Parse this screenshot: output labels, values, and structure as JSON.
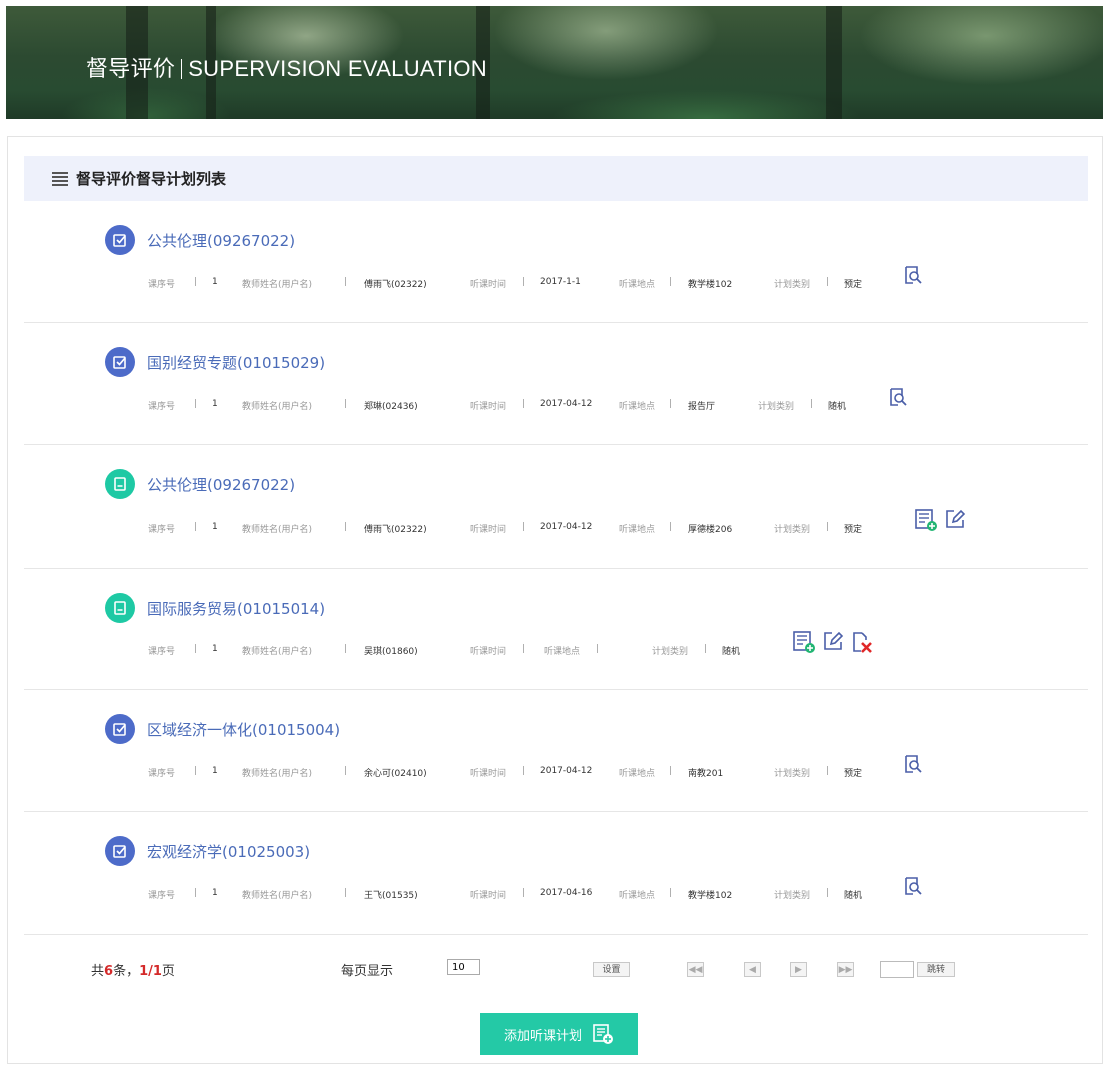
{
  "header": {
    "title_cn": "督导评价",
    "title_en": "SUPERVISION EVALUATION"
  },
  "panel": {
    "title": "督导评价督导计划列表"
  },
  "labels": {
    "seq": "课序号",
    "teacher": "教师姓名(用户名)",
    "time": "听课时间",
    "place": "听课地点",
    "category": "计划类别",
    "sep": "|"
  },
  "records": [
    {
      "status": "completed",
      "course": "公共伦理(09267022)",
      "seq": "1",
      "teacher": "傅雨飞(02322)",
      "time": "2017-1-1",
      "place": "教学楼102",
      "category": "预定",
      "actions": [
        "view-icon"
      ]
    },
    {
      "status": "completed",
      "course": "国别经贸专题(01015029)",
      "seq": "1",
      "teacher": "郑琳(02436)",
      "time": "2017-04-12",
      "place": "报告厅",
      "category": "随机",
      "actions": [
        "view-icon"
      ]
    },
    {
      "status": "pending",
      "course": "公共伦理(09267022)",
      "seq": "1",
      "teacher": "傅雨飞(02322)",
      "time": "2017-04-12",
      "place": "厚德楼206",
      "category": "预定",
      "actions": [
        "add-record-icon",
        "edit-icon"
      ]
    },
    {
      "status": "pending",
      "course": "国际服务贸易(01015014)",
      "seq": "1",
      "teacher": "吴琪(01860)",
      "time": "",
      "place": "",
      "category": "随机",
      "actions": [
        "add-record-icon",
        "edit-icon",
        "delete-icon"
      ]
    },
    {
      "status": "completed",
      "course": "区域经济一体化(01015004)",
      "seq": "1",
      "teacher": "余心可(02410)",
      "time": "2017-04-12",
      "place": "南教201",
      "category": "预定",
      "actions": [
        "view-icon"
      ]
    },
    {
      "status": "completed",
      "course": "宏观经济学(01025003)",
      "seq": "1",
      "teacher": "王飞(01535)",
      "time": "2017-04-16",
      "place": "教学楼102",
      "category": "随机",
      "actions": [
        "view-icon"
      ]
    }
  ],
  "pager": {
    "total_prefix": "共",
    "total_count": "6",
    "total_mid": "条，",
    "current_page": "1",
    "slash": "/",
    "total_pages": "1",
    "page_suffix": "页",
    "per_page_label": "每页显示",
    "per_page_value": "10",
    "set_button": "设置",
    "first": "◀◀",
    "prev": "◀",
    "next": "▶",
    "last": "▶▶",
    "jump_button": "跳转"
  },
  "add_button": {
    "label": "添加听课计划"
  },
  "colors": {
    "completed_icon": "#4d6bc9",
    "pending_icon": "#1ec9a4",
    "link": "#4a6bb8",
    "add_button": "#24c9a6",
    "header_band": "#eef1fb"
  }
}
